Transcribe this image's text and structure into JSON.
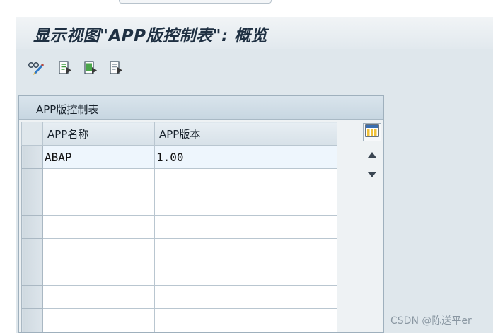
{
  "window": {
    "title": "显示视图\"APP版控制表\": 概览"
  },
  "toolbar": {
    "buttons": [
      {
        "name": "glasses-pencil-icon",
        "tooltip": ""
      },
      {
        "name": "export-icon",
        "tooltip": ""
      },
      {
        "name": "select-all-icon",
        "tooltip": ""
      },
      {
        "name": "deselect-icon",
        "tooltip": ""
      }
    ]
  },
  "table": {
    "title": "APP版控制表",
    "columns": [
      "APP名称",
      "APP版本"
    ],
    "rows": [
      [
        "ABAP",
        "1.00"
      ],
      [
        "",
        ""
      ],
      [
        "",
        ""
      ],
      [
        "",
        ""
      ],
      [
        "",
        ""
      ],
      [
        "",
        ""
      ],
      [
        "",
        ""
      ],
      [
        "",
        ""
      ]
    ]
  },
  "watermark": "CSDN @陈送平er",
  "colors": {
    "frame_bg": "#dfe7ec",
    "title_text": "#1f3042",
    "header_bg": "#d7e1e8",
    "selected_row_bg": "#eef6fd"
  }
}
